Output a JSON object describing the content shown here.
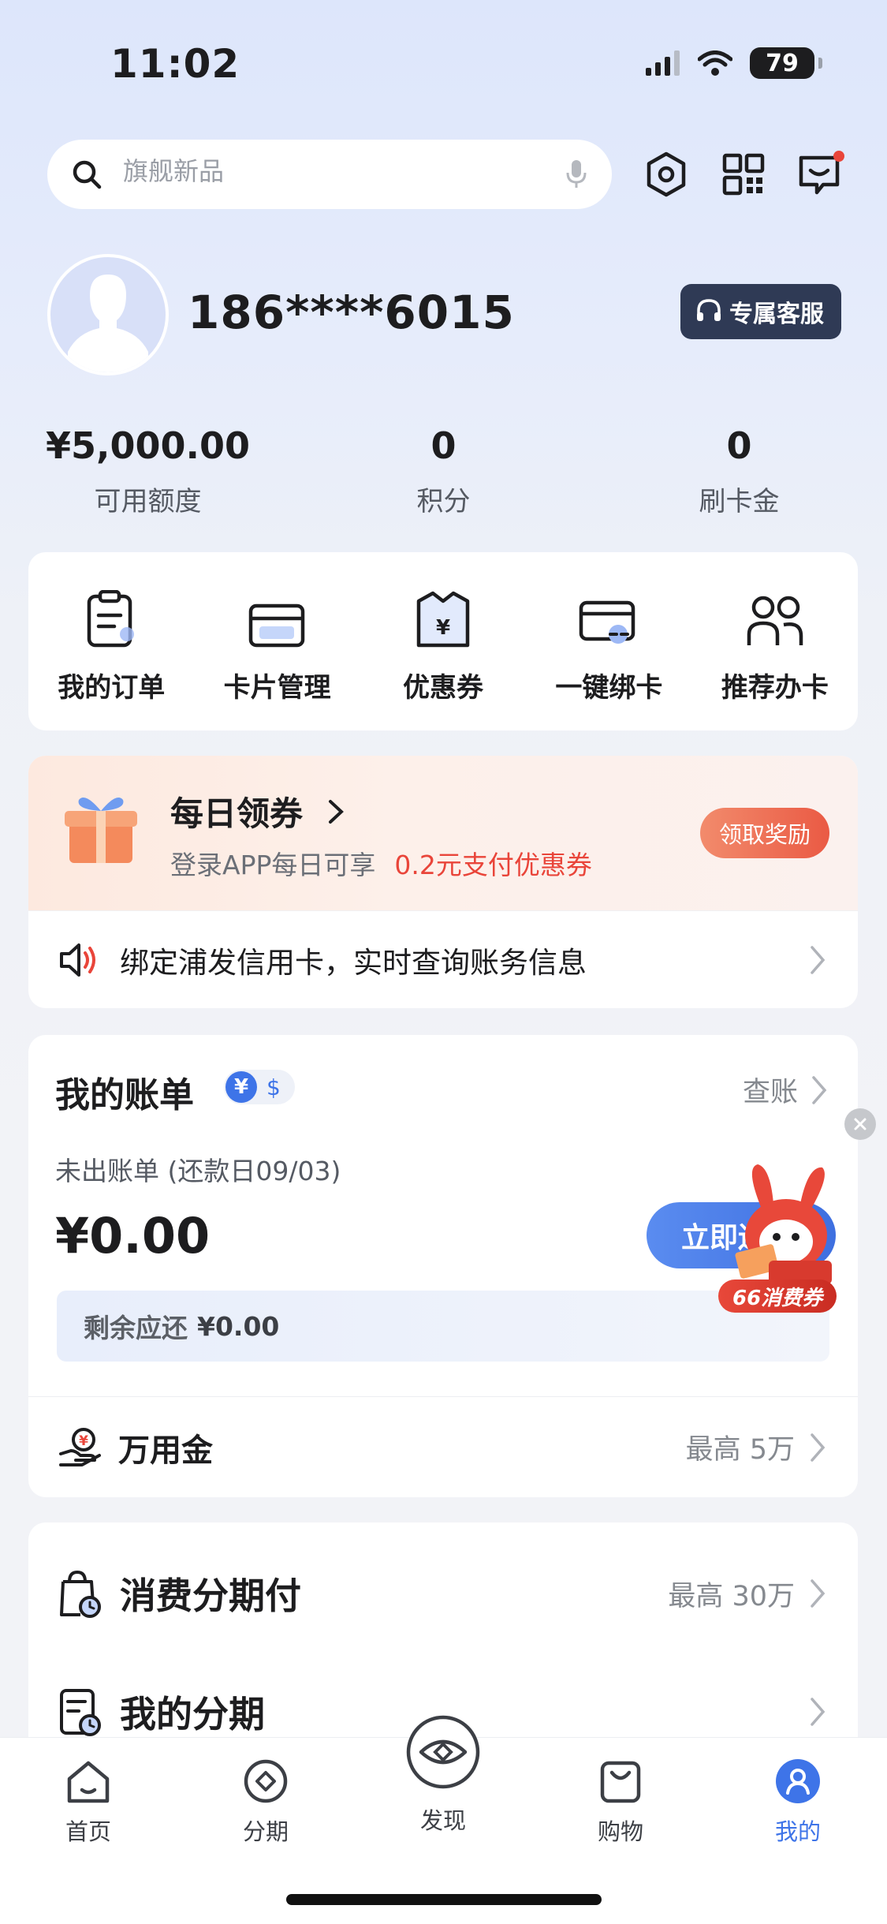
{
  "status_bar": {
    "time": "11:02",
    "battery": "79"
  },
  "search": {
    "placeholder": "旗舰新品"
  },
  "profile": {
    "username": "186****6015",
    "service_button": "专属客服"
  },
  "stats": [
    {
      "value": "¥5,000.00",
      "label": "可用额度"
    },
    {
      "value": "0",
      "label": "积分"
    },
    {
      "value": "0",
      "label": "刷卡金"
    }
  ],
  "quick_menu": [
    {
      "label": "我的订单",
      "icon": "clipboard-icon"
    },
    {
      "label": "卡片管理",
      "icon": "card-icon"
    },
    {
      "label": "优惠券",
      "icon": "coupon-icon"
    },
    {
      "label": "一键绑卡",
      "icon": "link-card-icon"
    },
    {
      "label": "推荐办卡",
      "icon": "refer-icon"
    }
  ],
  "promo": {
    "title": "每日领券",
    "subtitle": "登录APP每日可享",
    "highlight": "0.2元支付优惠券",
    "button": "领取奖励",
    "notice": "绑定浦发信用卡，实时查询账务信息"
  },
  "bill": {
    "title": "我的账单",
    "toggle_on": "¥",
    "toggle_off": "$",
    "check": "查账",
    "subtitle": "未出账单 (还款日09/03)",
    "amount": "¥0.00",
    "repay_button": "立即还",
    "remaining_label": "剩余应还",
    "remaining_value": "¥0.00",
    "wanyong_label": "万用金",
    "wanyong_right": "最高 5万",
    "mascot_badge": "66消费券"
  },
  "installment": {
    "row1_label": "消费分期付",
    "row1_right": "最高 30万",
    "row2_label": "我的分期"
  },
  "tabs": [
    {
      "label": "首页"
    },
    {
      "label": "分期"
    },
    {
      "label": "发现"
    },
    {
      "label": "购物"
    },
    {
      "label": "我的"
    }
  ],
  "colors": {
    "accent": "#3e74e8",
    "promo_red": "#e9453a"
  }
}
